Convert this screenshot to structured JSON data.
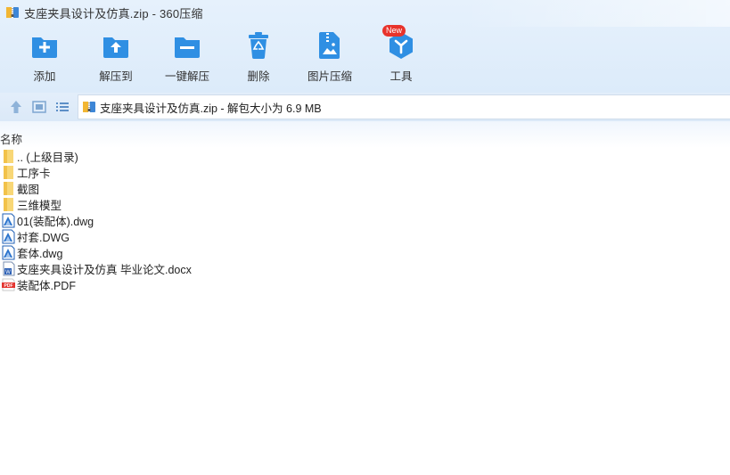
{
  "window": {
    "title": "支座夹具设计及仿真.zip - 360压缩"
  },
  "toolbar": {
    "add": "添加",
    "extract_to": "解压到",
    "one_click_extract": "一键解压",
    "delete": "删除",
    "image_compress": "图片压缩",
    "tools": "工具",
    "new_badge": "New"
  },
  "address": {
    "text": "支座夹具设计及仿真.zip - 解包大小为 6.9 MB"
  },
  "list_header": {
    "name_col": "名称"
  },
  "files": [
    {
      "name": ".. (上级目录)",
      "type": "folder-icon"
    },
    {
      "name": "工序卡",
      "type": "folder-icon"
    },
    {
      "name": "截图",
      "type": "folder-icon"
    },
    {
      "name": "三维模型",
      "type": "folder-icon"
    },
    {
      "name": "01(装配体).dwg",
      "type": "dwg-file-icon"
    },
    {
      "name": "衬套.DWG",
      "type": "dwg-file-icon"
    },
    {
      "name": "套体.dwg",
      "type": "dwg-file-icon"
    },
    {
      "name": "支座夹具设计及仿真 毕业论文.docx",
      "type": "word-file-icon"
    },
    {
      "name": "装配体.PDF",
      "type": "pdf-file-icon"
    }
  ],
  "colors": {
    "accent_blue": "#2f8fe3",
    "chrome_bg": "#dcebfa",
    "badge_red": "#e8332b",
    "folder_yellow": "#f8d776"
  }
}
